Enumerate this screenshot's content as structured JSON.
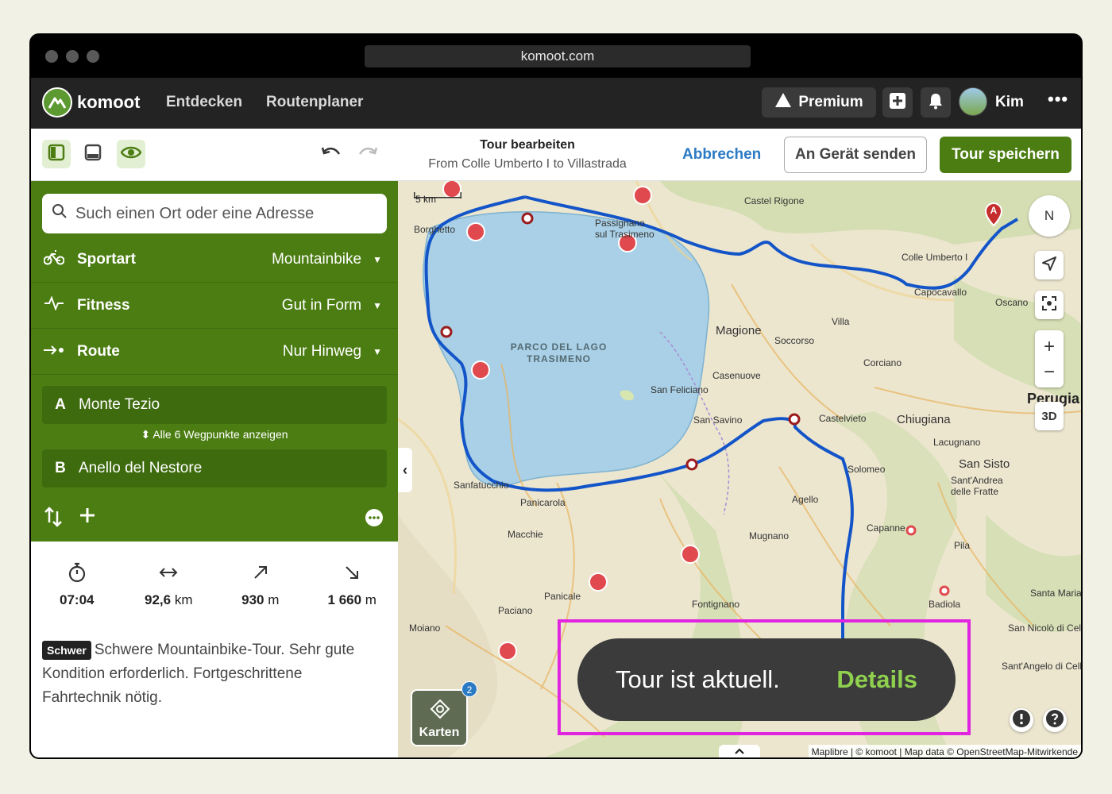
{
  "browser": {
    "url": "komoot.com"
  },
  "nav": {
    "brand": "komoot",
    "links": [
      "Entdecken",
      "Routenplaner"
    ],
    "premium": "Premium",
    "user": "Kim"
  },
  "toolbar": {
    "title": "Tour bearbeiten",
    "subtitle": "From Colle Umberto I to Villastrada",
    "cancel": "Abbrechen",
    "send": "An Gerät senden",
    "save": "Tour speichern"
  },
  "planner": {
    "search_placeholder": "Such einen Ort oder eine Adresse",
    "settings": [
      {
        "label": "Sportart",
        "value": "Mountainbike"
      },
      {
        "label": "Fitness",
        "value": "Gut in Form"
      },
      {
        "label": "Route",
        "value": "Nur Hinweg"
      }
    ],
    "waypoint_a": {
      "key": "A",
      "name": "Monte Tezio"
    },
    "show_all": "Alle 6 Wegpunkte anzeigen",
    "waypoint_b": {
      "key": "B",
      "name": "Anello del Nestore"
    }
  },
  "stats": {
    "duration": "07:04",
    "distance_value": "92,6",
    "distance_unit": "km",
    "up_value": "930",
    "up_unit": "m",
    "down_value": "1 660",
    "down_unit": "m"
  },
  "difficulty": {
    "badge": "Schwer",
    "text": "Schwere Mountainbike-Tour. Sehr gute Kondition erforderlich. Fortgeschrittene Fahrtechnik nötig."
  },
  "map": {
    "scale": "5 km",
    "compass": "N",
    "toggle3d": "3D",
    "park_label": "PARCO DEL LAGO TRASIMENO",
    "places": [
      "Castel Rigone",
      "Passignano sul Trasimeno",
      "Colle Umberto I",
      "Capocavallo",
      "Oscano",
      "Magione",
      "Villa",
      "Soccorso",
      "Corciano",
      "Casenuove",
      "San Feliciano",
      "San Savino",
      "Castelvieto",
      "Chiugiana",
      "Lacugnano",
      "San Sisto",
      "Solomeo",
      "Sant'Andrea delle Fratte",
      "Agello",
      "Capanne",
      "Pila",
      "Mugnano",
      "Panicarola",
      "Macchie",
      "Sanfatucchio",
      "Panicale",
      "Paciano",
      "Fontignano",
      "Badiola",
      "Santa Maria",
      "San Nicolò di Celle",
      "Sant'Angelo di Celle",
      "Borghetto",
      "Moiano",
      "Perugia"
    ],
    "layers_label": "Karten",
    "layers_count": "2",
    "attribution": "Maplibre | © komoot | Map data © OpenStreetMap-Mitwirkende",
    "marker_a": "A"
  },
  "toast": {
    "message": "Tour ist aktuell.",
    "action": "Details"
  },
  "colors": {
    "primary": "#4b7d12",
    "route": "#1355c8",
    "link": "#2b7bc4",
    "highlight": "#e024e0"
  }
}
